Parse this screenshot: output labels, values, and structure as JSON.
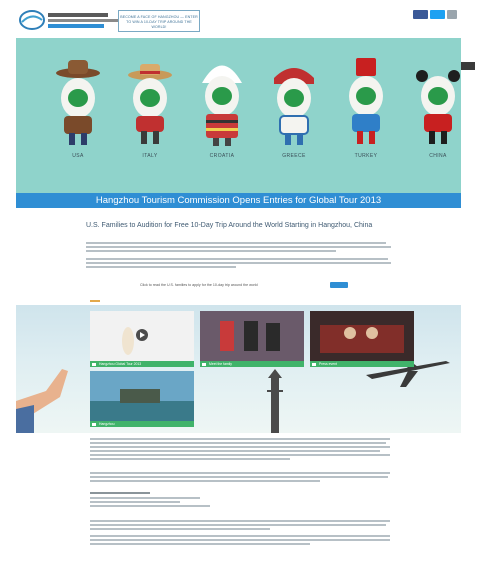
{
  "header": {
    "logo_label": "Hangzhou Tourism Commission",
    "promo_text": "BECOME A FACE OF HANGZHOU — ENTER TO WIN A 10-DAY TRIP AROUND THE WORLD!",
    "social_colors": [
      "#3b5998",
      "#1da1f2",
      "#9aa5ad"
    ]
  },
  "hero": {
    "background": "#8fd3cb",
    "mascots": [
      {
        "country": "USA",
        "hat": "cowboy-hat"
      },
      {
        "country": "ITALY",
        "hat": "straw-hat"
      },
      {
        "country": "CROATIA",
        "hat": "white-cap"
      },
      {
        "country": "GREECE",
        "hat": "red-headband"
      },
      {
        "country": "TURKEY",
        "hat": "fez"
      },
      {
        "country": "CHINA",
        "hat": "panda-ears"
      }
    ]
  },
  "banner": {
    "title": "Hangzhou Tourism Commission Opens Entries for Global Tour 2013"
  },
  "article": {
    "headline": "U.S. Families to Audition for Free 10-Day Trip Around the World Starting in Hangzhou, China",
    "cta_text": "Click to read the U.S. families to apply for the 10-day trip around the world",
    "cta_button": "APPLY",
    "accent": "#2f8ed4"
  },
  "videos": [
    {
      "caption": "Hangzhou Global Tour 2013"
    },
    {
      "caption": "Meet the family"
    },
    {
      "caption": "Press event"
    },
    {
      "caption": "Hangzhou"
    }
  ],
  "colors": {
    "caption_bar": "#40b36a",
    "banner": "#2f8ed4"
  }
}
